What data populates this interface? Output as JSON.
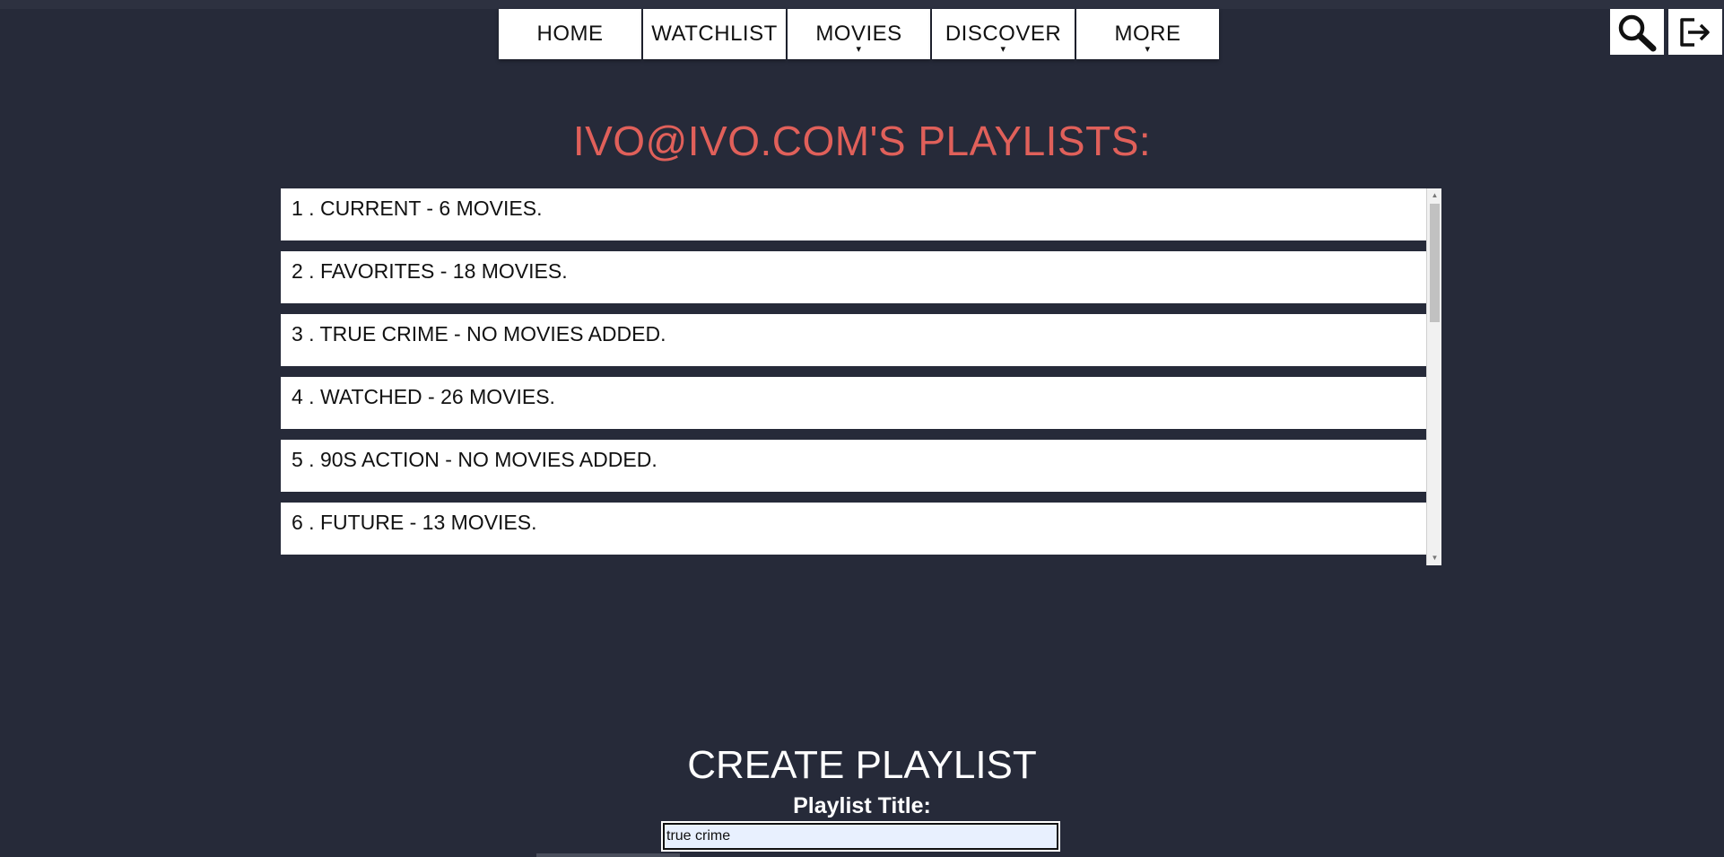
{
  "nav": {
    "items": [
      {
        "label": "HOME",
        "dropdown": false
      },
      {
        "label": "WATCHLIST",
        "dropdown": false
      },
      {
        "label": "MOVIES",
        "dropdown": true
      },
      {
        "label": "DISCOVER",
        "dropdown": true
      },
      {
        "label": "MORE",
        "dropdown": true
      }
    ],
    "caret": "▾",
    "search_icon": "search-icon",
    "logout_icon": "logout-icon"
  },
  "page": {
    "title": "IVO@IVO.COM'S PLAYLISTS:",
    "title_color": "#e0605a",
    "background": "#262a39"
  },
  "playlists": [
    {
      "text": "1 . CURRENT - 6 MOVIES."
    },
    {
      "text": "2 . FAVORITES - 18 MOVIES."
    },
    {
      "text": "3 . TRUE CRIME - NO MOVIES ADDED."
    },
    {
      "text": "4 . WATCHED - 26 MOVIES."
    },
    {
      "text": "5 . 90S ACTION - NO MOVIES ADDED."
    },
    {
      "text": "6 . FUTURE - 13 MOVIES."
    }
  ],
  "create": {
    "title": "CREATE PLAYLIST",
    "label": "Playlist Title:",
    "input_value": "true crime"
  }
}
